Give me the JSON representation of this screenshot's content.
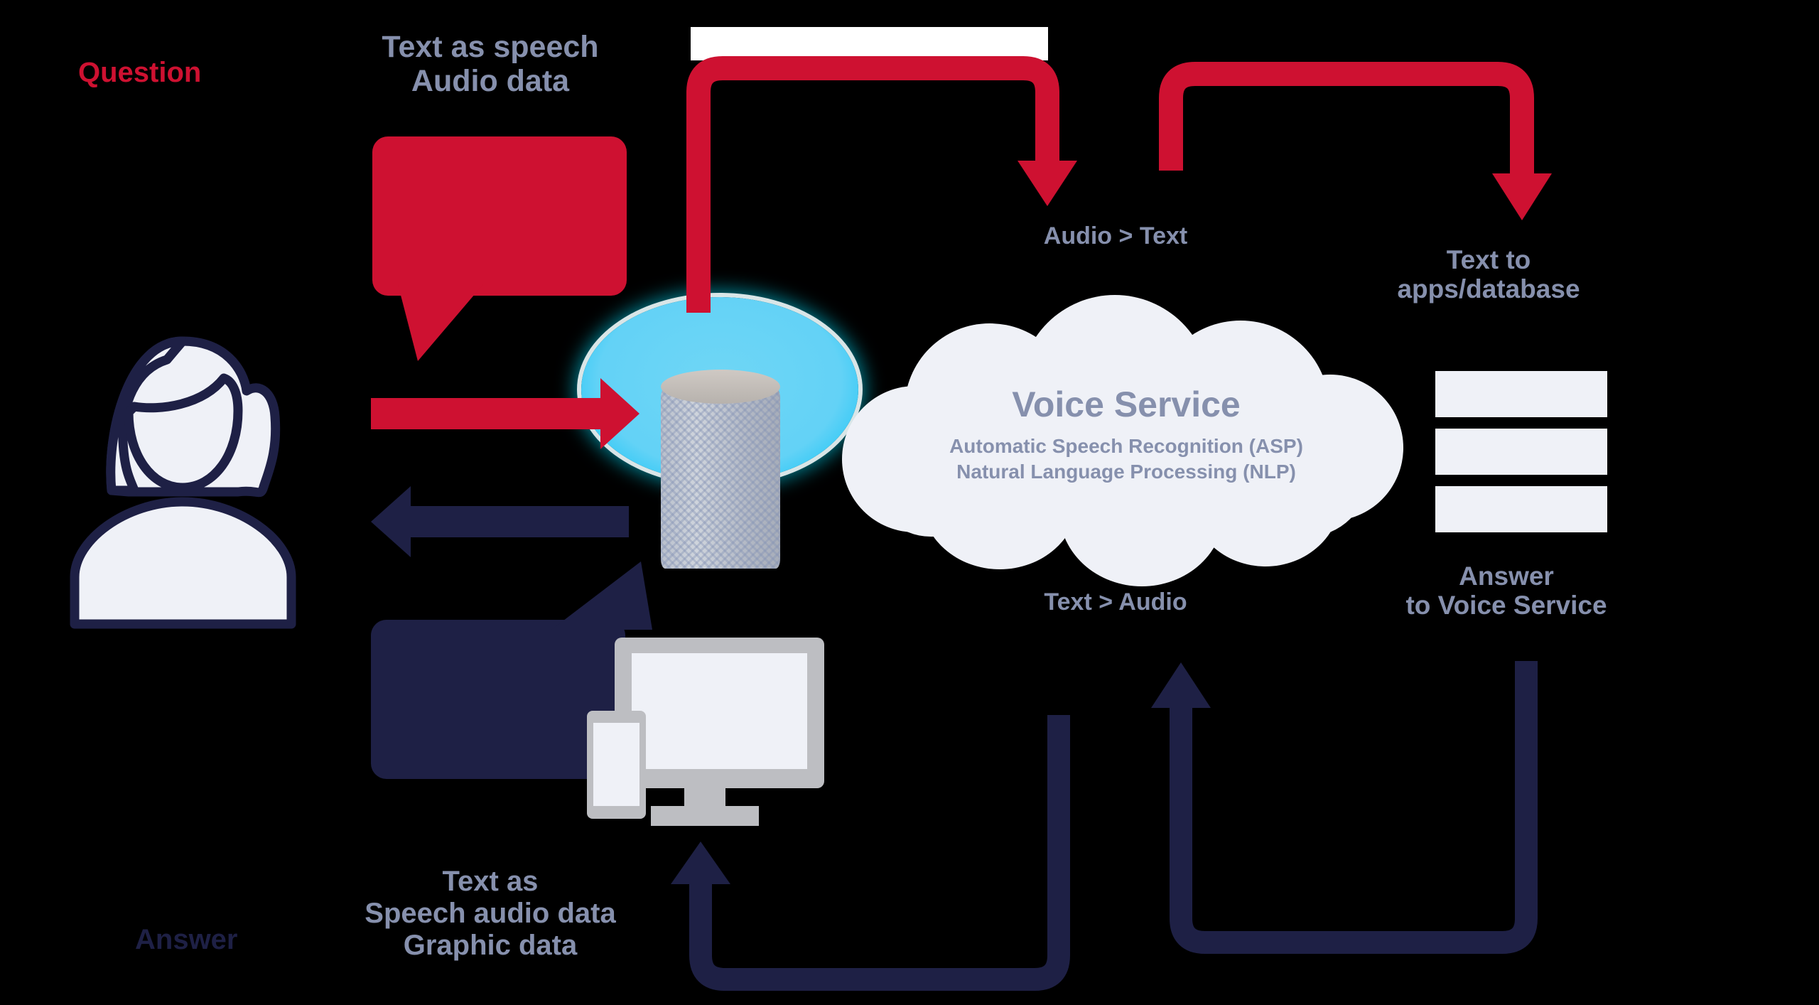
{
  "diagram": {
    "title_flow": "Voice assistant question and answer flow",
    "colors": {
      "red": "#ce1131",
      "navy": "#1e2045",
      "slate": "#8690ad",
      "cloud": "#eff1f7",
      "glow_cyan": "#0ad4ff",
      "device_gray": "#bdbec2"
    }
  },
  "labels": {
    "question": "Question",
    "answer": "Answer",
    "text_as_speech_audio": "Text as speech\nAudio data",
    "audio_to_text": "Audio > Text",
    "text_to_apps_database": "Text to\napps/database",
    "text_to_audio": "Text > Audio",
    "answer_to_voice_service": "Answer\nto Voice Service",
    "text_as_speech_graphic": "Text as\nSpeech audio data\nGraphic data"
  },
  "cloud": {
    "title": "Voice Service",
    "line1": "Automatic Speech Recognition (ASP)",
    "line2": "Natural Language Processing (NLP)"
  },
  "icons": {
    "person": "person-female-icon",
    "smart_speaker": "smart-speaker-icon",
    "cloud": "cloud-icon",
    "monitor": "monitor-icon",
    "phone": "smartphone-icon",
    "database": "database-stack-icon",
    "speech_bubble_question": "speech-bubble-icon",
    "speech_bubble_answer": "speech-bubble-icon"
  }
}
